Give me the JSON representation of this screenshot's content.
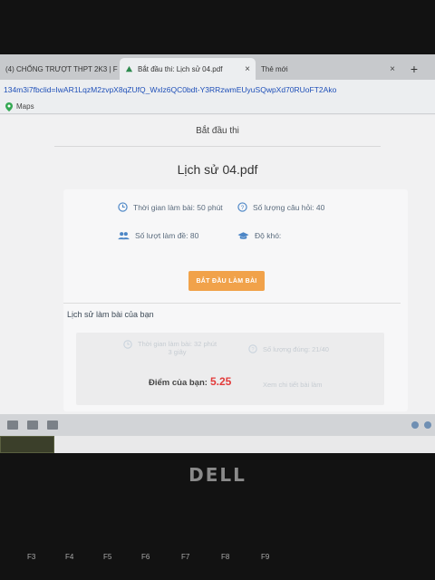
{
  "browser": {
    "tabs": [
      {
        "label": "(4) CHỐNG TRƯỢT THPT 2K3 | F",
        "active": false
      },
      {
        "label": "Bắt đầu thi: Lịch sử 04.pdf",
        "active": true
      },
      {
        "label": "Thẻ mới",
        "active": false
      }
    ],
    "new_tab_symbol": "+",
    "close_symbol": "×",
    "address": "134m3i7fbclid=IwAR1LqzM2zvpX8qZUfQ_Wxlz6QC0bdt-Y3RRzwmEUyuSQwpXd70RUoFT2Ako",
    "bookmarks": [
      {
        "label": "Maps"
      }
    ]
  },
  "page": {
    "heading": "Bắt đầu thi",
    "file_title": "Lịch sử 04.pdf",
    "info": {
      "time_label": "Thời gian làm bài: 50 phút",
      "questions_label": "Số lượng câu hỏi: 40",
      "attempts_label": "Số lượt làm đề: 80",
      "difficulty_label": "Độ khó:"
    },
    "start_button": "BẮT ĐẦU LÀM BÀI",
    "history_title": "Lịch sử làm bài của bạn",
    "history": {
      "time_taken_line1": "Thời gian làm bài: 32 phút",
      "time_taken_line2": "3 giây",
      "correct_count": "Số lượng đúng: 21/40",
      "score_label": "Điểm của bạn:",
      "score_value": "5.25",
      "detail_link": "Xem chi tiết bài làm"
    }
  },
  "device": {
    "logo": "DELL",
    "fkeys": [
      "F3",
      "F4",
      "F5",
      "F6",
      "F7",
      "F8",
      "F9"
    ]
  },
  "colors": {
    "accent_orange": "#f1a24a",
    "score_red": "#e23b3b",
    "icon_blue": "#4c86c6"
  }
}
